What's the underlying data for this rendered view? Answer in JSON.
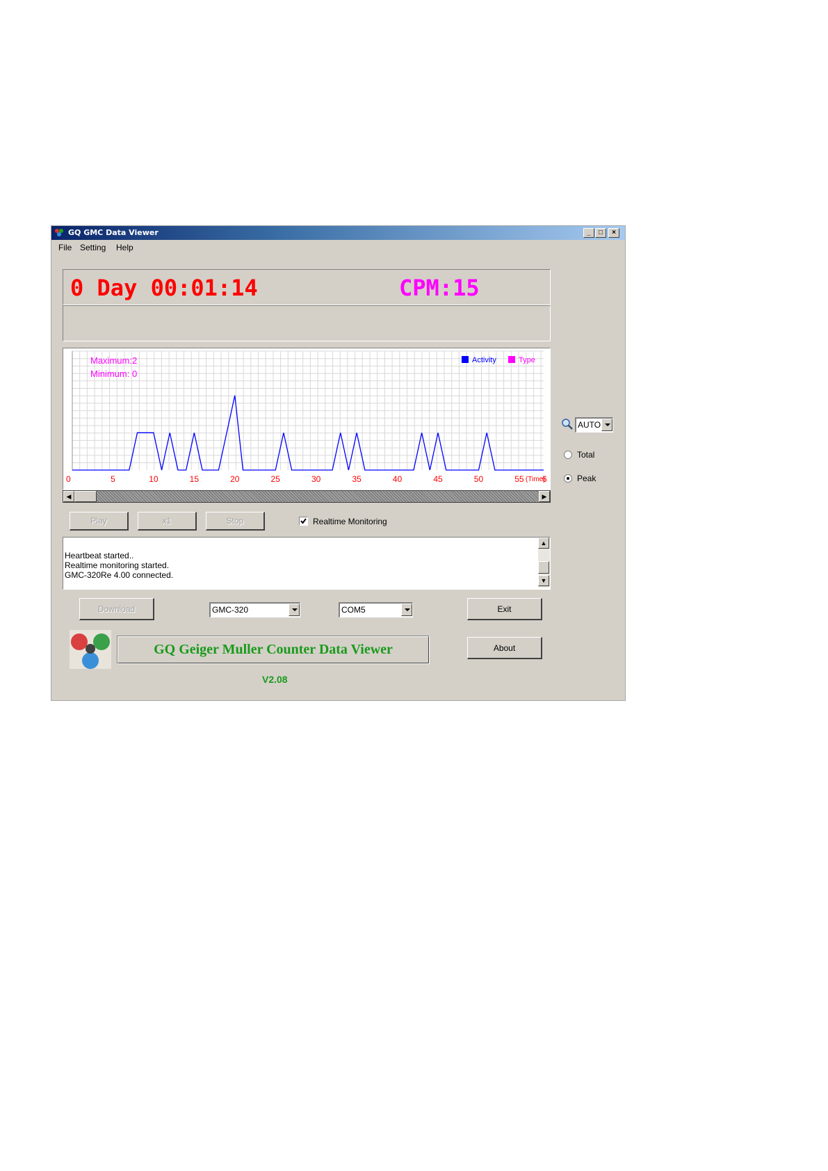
{
  "window": {
    "title": "GQ GMC Data Viewer",
    "controls": {
      "minimize": "_",
      "maximize": "□",
      "close": "×"
    }
  },
  "menu": {
    "items": [
      "File",
      "Setting",
      "Help"
    ]
  },
  "display": {
    "timer": "0 Day 00:01:14",
    "cpm": "CPM:15",
    "timer_color": "#ff0000",
    "cpm_color": "#ff00ff"
  },
  "chart_data": {
    "type": "line",
    "annotations": {
      "maximum": "Maximum:2",
      "minimum": "Minimum: 0"
    },
    "legend": [
      {
        "label": "Activity",
        "color": "#0000ff"
      },
      {
        "label": "Type",
        "color": "#ff00ff"
      }
    ],
    "legend_position": "top-right",
    "x_ticks": [
      "0",
      "5",
      "10",
      "15",
      "20",
      "25",
      "30",
      "35",
      "40",
      "45",
      "50",
      "55"
    ],
    "x_axis_label": "(Time)",
    "x_trailing_label": "6",
    "xlim": [
      0,
      58
    ],
    "ylim": [
      0,
      3
    ],
    "grid": true,
    "series": [
      {
        "color": "#0000ff",
        "x": [
          0,
          7,
          8,
          10,
          11,
          12,
          13,
          14,
          15,
          16,
          18,
          19,
          20,
          21,
          25,
          26,
          27,
          32,
          33,
          34,
          35,
          36,
          42,
          43,
          44,
          45,
          46,
          50,
          51,
          52,
          58
        ],
        "y": [
          0,
          0,
          1,
          1,
          0,
          1,
          0,
          0,
          1,
          0,
          0,
          1,
          2,
          0,
          0,
          1,
          0,
          0,
          1,
          0,
          1,
          0,
          0,
          1,
          0,
          1,
          0,
          0,
          1,
          0,
          0
        ]
      }
    ]
  },
  "playback": {
    "play": "Play",
    "speed": "x1",
    "stop": "Stop",
    "realtime_label": "Realtime Monitoring",
    "realtime_checked": true
  },
  "log": {
    "lines": [
      "Heartbeat started..",
      "Realtime monitoring started.",
      "GMC-320Re 4.00 connected."
    ]
  },
  "side": {
    "zoom_value": "AUTO",
    "total_label": "Total",
    "peak_label": "Peak",
    "selected": "Peak"
  },
  "bottom": {
    "download": "Download",
    "model": "GMC-320",
    "port": "COM5",
    "exit": "Exit",
    "about": "About",
    "banner": "GQ Geiger Muller Counter Data Viewer",
    "version": "V2.08",
    "banner_color": "#1a9a1a"
  }
}
